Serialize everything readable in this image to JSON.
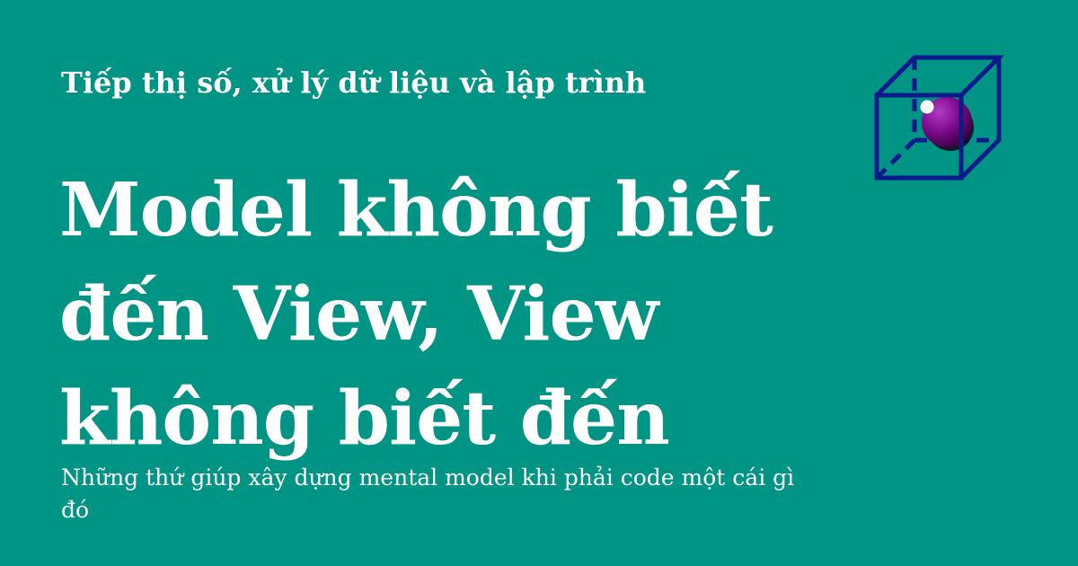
{
  "site": {
    "name": "Tiếp thị số, xử lý dữ liệu và lập trình"
  },
  "post": {
    "title": "Model không biết đến View, View không biết đến",
    "description": "Những thứ giúp xây dựng mental model khi phải code một cái gì đó"
  },
  "logo": {
    "icon": "cube-with-sphere-icon",
    "cube_color": "#0d1a8c",
    "sphere_color": "#7a0a8a"
  },
  "colors": {
    "background": "#009485",
    "text": "#ffffff"
  }
}
